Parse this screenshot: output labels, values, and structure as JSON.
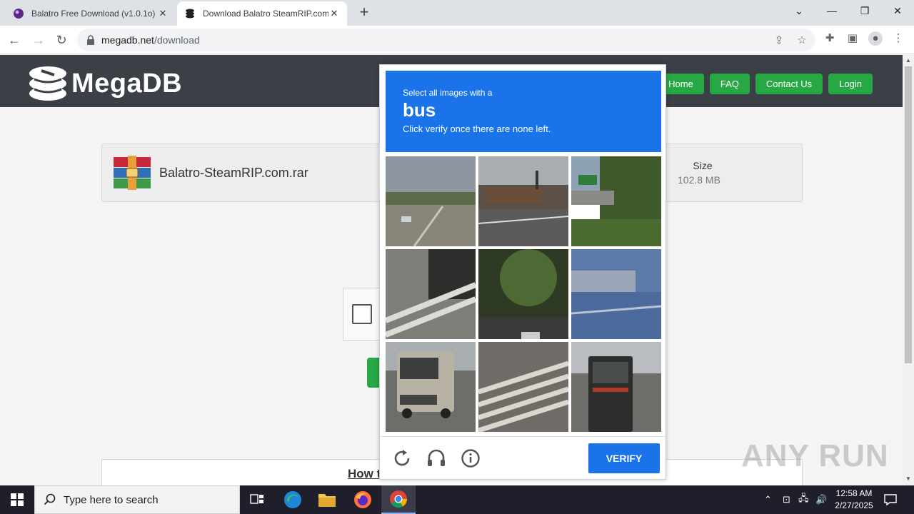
{
  "browser": {
    "tabs": [
      {
        "title": "Balatro Free Download (v1.0.1o)",
        "active": false
      },
      {
        "title": "Download Balatro SteamRIP.com",
        "active": true
      }
    ],
    "url_host": "megadb.net",
    "url_path": "/download"
  },
  "site": {
    "logo_text": "MegaDB",
    "nav": [
      "Home",
      "FAQ",
      "Contact Us",
      "Login"
    ],
    "file_name": "Balatro-SteamRIP.com.rar",
    "size_label": "Size",
    "size_value": "102.8 MB",
    "howto_text": "How t"
  },
  "captcha": {
    "prompt_line1": "Select all images with a",
    "prompt_object": "bus",
    "prompt_line3": "Click verify once there are none left.",
    "verify_label": "VERIFY",
    "accent": "#1a73e8"
  },
  "watermark": "ANY RUN",
  "taskbar": {
    "search_placeholder": "Type here to search",
    "time": "12:58 AM",
    "date": "2/27/2025"
  }
}
